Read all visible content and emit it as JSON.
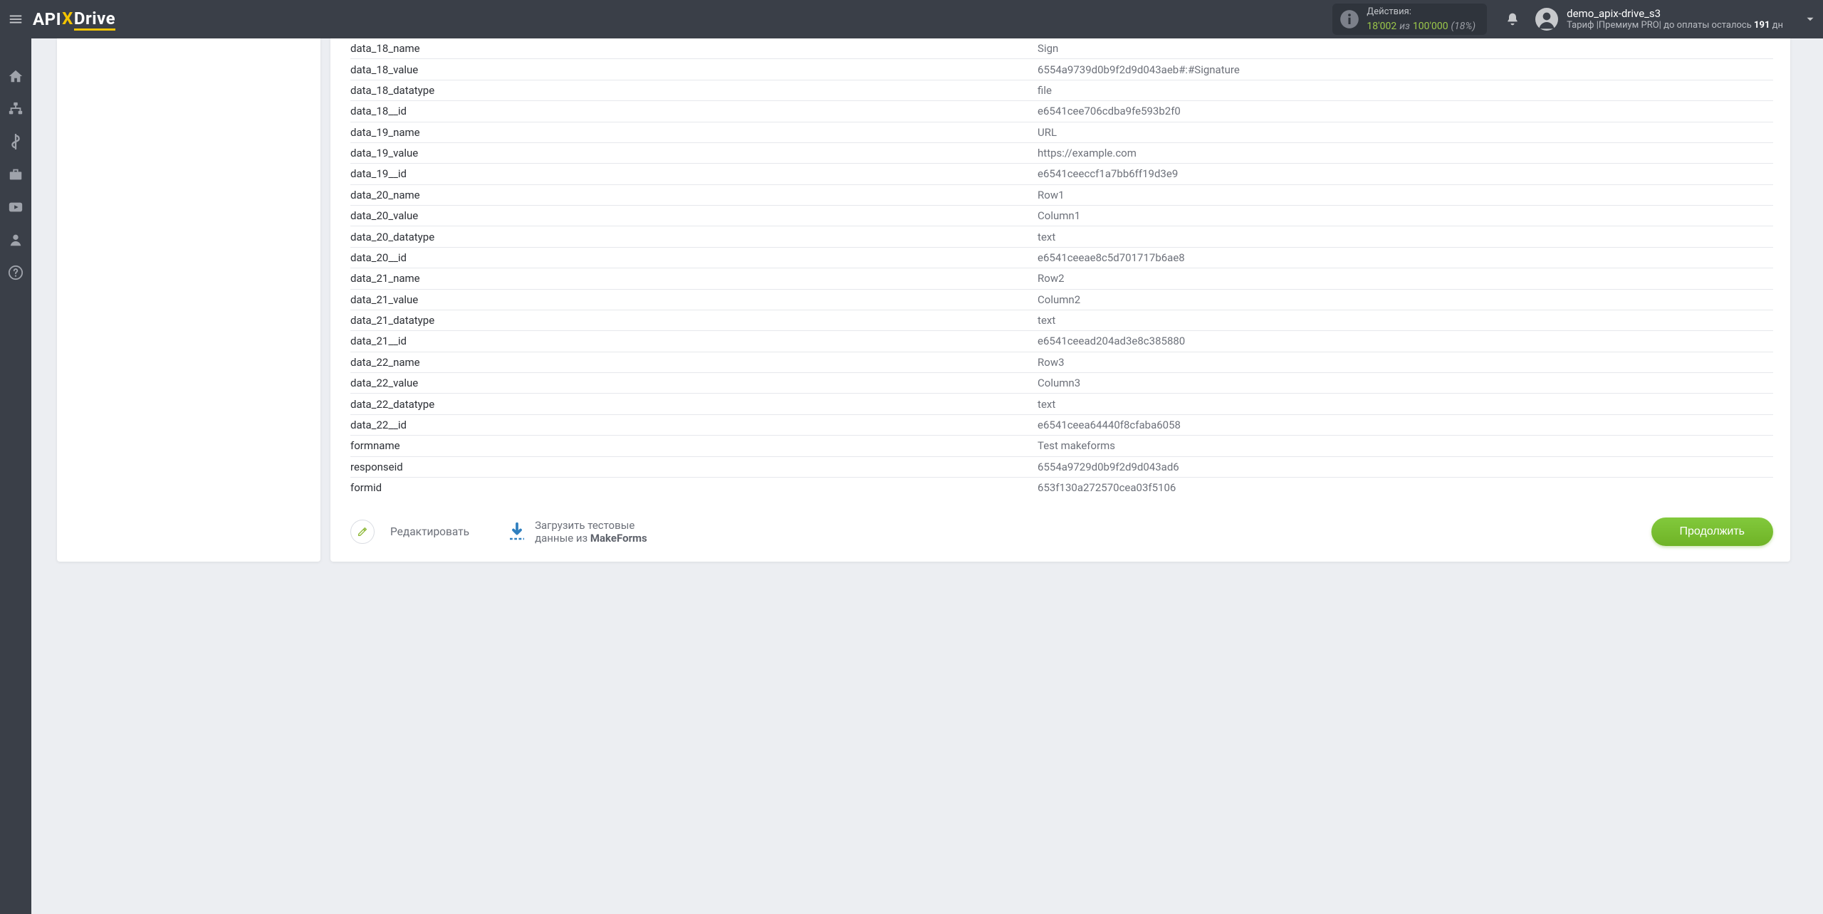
{
  "brand": {
    "part1": "API",
    "x": "X",
    "part2": "Drive"
  },
  "header": {
    "actions_label": "Действия:",
    "actions_used": "18'002",
    "actions_of": "из",
    "actions_total": "100'000",
    "actions_pct": "(18%)",
    "user": "demo_apix-drive_s3",
    "tariff_prefix": "Тариф |",
    "tariff_name": "Премиум PRO",
    "tariff_sep": "|",
    "pay_left_prefix": "до оплаты осталось",
    "pay_days": "191",
    "pay_unit": "дн"
  },
  "rows": [
    {
      "k": "data_18_name",
      "v": "Sign"
    },
    {
      "k": "data_18_value",
      "v": "6554a9739d0b9f2d9d043aeb#:#Signature"
    },
    {
      "k": "data_18_datatype",
      "v": "file"
    },
    {
      "k": "data_18__id",
      "v": "e6541cee706cdba9fe593b2f0"
    },
    {
      "k": "data_19_name",
      "v": "URL"
    },
    {
      "k": "data_19_value",
      "v": "https://example.com"
    },
    {
      "k": "data_19__id",
      "v": "e6541ceeccf1a7bb6ff19d3e9"
    },
    {
      "k": "data_20_name",
      "v": "Row1"
    },
    {
      "k": "data_20_value",
      "v": "Column1"
    },
    {
      "k": "data_20_datatype",
      "v": "text"
    },
    {
      "k": "data_20__id",
      "v": "e6541ceeae8c5d701717b6ae8"
    },
    {
      "k": "data_21_name",
      "v": "Row2"
    },
    {
      "k": "data_21_value",
      "v": "Column2"
    },
    {
      "k": "data_21_datatype",
      "v": "text"
    },
    {
      "k": "data_21__id",
      "v": "e6541ceead204ad3e8c385880"
    },
    {
      "k": "data_22_name",
      "v": "Row3"
    },
    {
      "k": "data_22_value",
      "v": "Column3"
    },
    {
      "k": "data_22_datatype",
      "v": "text"
    },
    {
      "k": "data_22__id",
      "v": "e6541ceea64440f8cfaba6058"
    },
    {
      "k": "formname",
      "v": "Test makeforms"
    },
    {
      "k": "responseid",
      "v": "6554a9729d0b9f2d9d043ad6"
    },
    {
      "k": "formid",
      "v": "653f130a272570cea03f5106"
    }
  ],
  "toolbar": {
    "edit": "Редактировать",
    "load_line1": "Загрузить тестовые",
    "load_line2_a": "данные из ",
    "load_line2_b": "MakeForms",
    "continue": "Продолжить"
  }
}
